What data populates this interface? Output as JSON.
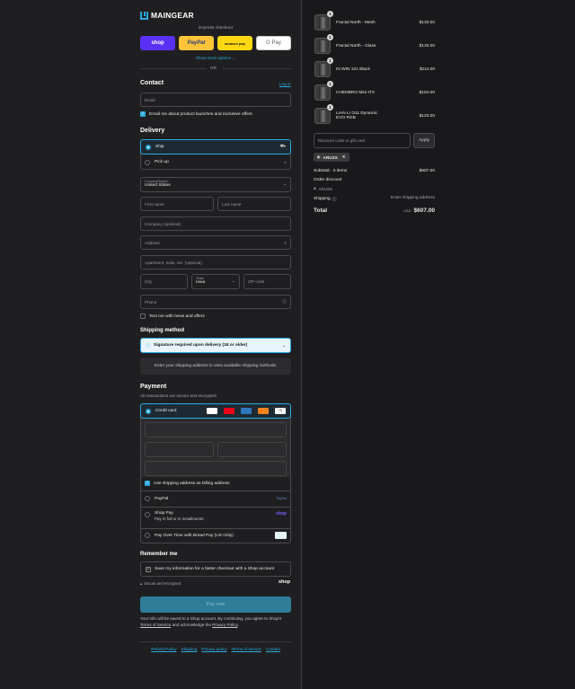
{
  "brand": {
    "name": "MAINGEAR"
  },
  "express": {
    "label": "Express checkout",
    "buttons": {
      "shop": "shop",
      "paypal": "PayPal",
      "amazon": "amazon pay",
      "gpay": "G Pay"
    },
    "more": "Show more options",
    "or": "OR"
  },
  "contact": {
    "title": "Contact",
    "login": "Log in",
    "email_placeholder": "Email",
    "email_opt": "Email me about product launches and exclusive offers"
  },
  "delivery": {
    "title": "Delivery",
    "ship": "Ship",
    "pickup": "Pick up",
    "country_label": "Country/Region",
    "country_value": "United States",
    "first_name": "First name",
    "last_name": "Last name",
    "company": "Company (optional)",
    "address": "Address",
    "apartment": "Apartment, suite, etc. (optional)",
    "city": "City",
    "state_label": "State",
    "state_value": "Iowa",
    "zip": "ZIP code",
    "phone": "Phone",
    "text_opt": "Text me with news and offers"
  },
  "shipping_method": {
    "title": "Shipping method",
    "notice": "Signature required upon delivery (18 or older)",
    "info": "Enter your shipping address to view available shipping methods."
  },
  "payment": {
    "title": "Payment",
    "subtitle": "All transactions are secure and encrypted.",
    "credit_card": "Credit card",
    "billing_same": "Use shipping address as billing address",
    "paypal": "PayPal",
    "shop_pay": "Shop Pay",
    "shop_pay_sub": "Pay in full or in installments",
    "bread": "Pay Over Time with Bread Pay (US Only)",
    "card_more": "+5"
  },
  "remember": {
    "title": "Remember me",
    "save": "Save my information for a faster checkout with a Shop account",
    "secure": "Secure and encrypted",
    "shop": "shop"
  },
  "pay_now": "Pay now",
  "disclaimer": {
    "a": "Your info will be saved to a Shop account. By continuing, you agree to Shop's",
    "tos": "Terms of Service",
    "b": "and acknowledge the",
    "privacy": "Privacy Policy",
    "c": "."
  },
  "footer_links": [
    "Refund Policy",
    "Shipping",
    "Privacy policy",
    "Terms of service",
    "Contact"
  ],
  "cart": {
    "items": [
      {
        "title": "Fractal North - Mesh",
        "price": "$133.00",
        "qty": "1"
      },
      {
        "title": "Fractal North - Glass",
        "price": "$133.00",
        "qty": "1"
      },
      {
        "title": "IN WIN 101 Black",
        "price": "$114.00",
        "qty": "1"
      },
      {
        "title": "CHENBRO Mini-ITX",
        "price": "$104.00",
        "qty": "1"
      },
      {
        "title": "LIAN LI O11 Dynamic EVO RGB",
        "price": "$123.00",
        "qty": "1"
      }
    ],
    "discount_placeholder": "Discount code or gift card",
    "apply": "Apply",
    "applied_code": "ARUSS",
    "subtotal_label": "Subtotal · 5 items",
    "subtotal_value": "$607.00",
    "order_discount": "Order discount",
    "discount_code": "ARUSS",
    "shipping_label": "Shipping",
    "shipping_value": "Enter shipping address",
    "total_label": "Total",
    "currency": "USD",
    "total_value": "$607.00"
  }
}
